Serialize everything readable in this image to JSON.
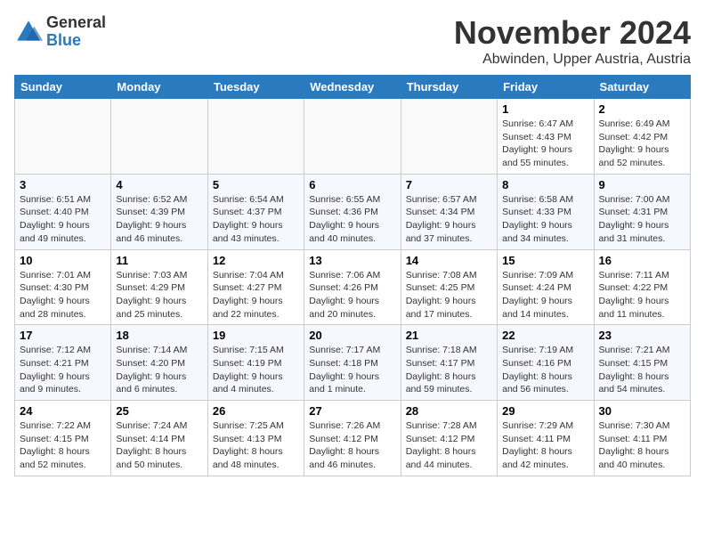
{
  "logo": {
    "general": "General",
    "blue": "Blue"
  },
  "header": {
    "month": "November 2024",
    "location": "Abwinden, Upper Austria, Austria"
  },
  "weekdays": [
    "Sunday",
    "Monday",
    "Tuesday",
    "Wednesday",
    "Thursday",
    "Friday",
    "Saturday"
  ],
  "weeks": [
    [
      {
        "day": "",
        "info": ""
      },
      {
        "day": "",
        "info": ""
      },
      {
        "day": "",
        "info": ""
      },
      {
        "day": "",
        "info": ""
      },
      {
        "day": "",
        "info": ""
      },
      {
        "day": "1",
        "info": "Sunrise: 6:47 AM\nSunset: 4:43 PM\nDaylight: 9 hours\nand 55 minutes."
      },
      {
        "day": "2",
        "info": "Sunrise: 6:49 AM\nSunset: 4:42 PM\nDaylight: 9 hours\nand 52 minutes."
      }
    ],
    [
      {
        "day": "3",
        "info": "Sunrise: 6:51 AM\nSunset: 4:40 PM\nDaylight: 9 hours\nand 49 minutes."
      },
      {
        "day": "4",
        "info": "Sunrise: 6:52 AM\nSunset: 4:39 PM\nDaylight: 9 hours\nand 46 minutes."
      },
      {
        "day": "5",
        "info": "Sunrise: 6:54 AM\nSunset: 4:37 PM\nDaylight: 9 hours\nand 43 minutes."
      },
      {
        "day": "6",
        "info": "Sunrise: 6:55 AM\nSunset: 4:36 PM\nDaylight: 9 hours\nand 40 minutes."
      },
      {
        "day": "7",
        "info": "Sunrise: 6:57 AM\nSunset: 4:34 PM\nDaylight: 9 hours\nand 37 minutes."
      },
      {
        "day": "8",
        "info": "Sunrise: 6:58 AM\nSunset: 4:33 PM\nDaylight: 9 hours\nand 34 minutes."
      },
      {
        "day": "9",
        "info": "Sunrise: 7:00 AM\nSunset: 4:31 PM\nDaylight: 9 hours\nand 31 minutes."
      }
    ],
    [
      {
        "day": "10",
        "info": "Sunrise: 7:01 AM\nSunset: 4:30 PM\nDaylight: 9 hours\nand 28 minutes."
      },
      {
        "day": "11",
        "info": "Sunrise: 7:03 AM\nSunset: 4:29 PM\nDaylight: 9 hours\nand 25 minutes."
      },
      {
        "day": "12",
        "info": "Sunrise: 7:04 AM\nSunset: 4:27 PM\nDaylight: 9 hours\nand 22 minutes."
      },
      {
        "day": "13",
        "info": "Sunrise: 7:06 AM\nSunset: 4:26 PM\nDaylight: 9 hours\nand 20 minutes."
      },
      {
        "day": "14",
        "info": "Sunrise: 7:08 AM\nSunset: 4:25 PM\nDaylight: 9 hours\nand 17 minutes."
      },
      {
        "day": "15",
        "info": "Sunrise: 7:09 AM\nSunset: 4:24 PM\nDaylight: 9 hours\nand 14 minutes."
      },
      {
        "day": "16",
        "info": "Sunrise: 7:11 AM\nSunset: 4:22 PM\nDaylight: 9 hours\nand 11 minutes."
      }
    ],
    [
      {
        "day": "17",
        "info": "Sunrise: 7:12 AM\nSunset: 4:21 PM\nDaylight: 9 hours\nand 9 minutes."
      },
      {
        "day": "18",
        "info": "Sunrise: 7:14 AM\nSunset: 4:20 PM\nDaylight: 9 hours\nand 6 minutes."
      },
      {
        "day": "19",
        "info": "Sunrise: 7:15 AM\nSunset: 4:19 PM\nDaylight: 9 hours\nand 4 minutes."
      },
      {
        "day": "20",
        "info": "Sunrise: 7:17 AM\nSunset: 4:18 PM\nDaylight: 9 hours\nand 1 minute."
      },
      {
        "day": "21",
        "info": "Sunrise: 7:18 AM\nSunset: 4:17 PM\nDaylight: 8 hours\nand 59 minutes."
      },
      {
        "day": "22",
        "info": "Sunrise: 7:19 AM\nSunset: 4:16 PM\nDaylight: 8 hours\nand 56 minutes."
      },
      {
        "day": "23",
        "info": "Sunrise: 7:21 AM\nSunset: 4:15 PM\nDaylight: 8 hours\nand 54 minutes."
      }
    ],
    [
      {
        "day": "24",
        "info": "Sunrise: 7:22 AM\nSunset: 4:15 PM\nDaylight: 8 hours\nand 52 minutes."
      },
      {
        "day": "25",
        "info": "Sunrise: 7:24 AM\nSunset: 4:14 PM\nDaylight: 8 hours\nand 50 minutes."
      },
      {
        "day": "26",
        "info": "Sunrise: 7:25 AM\nSunset: 4:13 PM\nDaylight: 8 hours\nand 48 minutes."
      },
      {
        "day": "27",
        "info": "Sunrise: 7:26 AM\nSunset: 4:12 PM\nDaylight: 8 hours\nand 46 minutes."
      },
      {
        "day": "28",
        "info": "Sunrise: 7:28 AM\nSunset: 4:12 PM\nDaylight: 8 hours\nand 44 minutes."
      },
      {
        "day": "29",
        "info": "Sunrise: 7:29 AM\nSunset: 4:11 PM\nDaylight: 8 hours\nand 42 minutes."
      },
      {
        "day": "30",
        "info": "Sunrise: 7:30 AM\nSunset: 4:11 PM\nDaylight: 8 hours\nand 40 minutes."
      }
    ]
  ]
}
